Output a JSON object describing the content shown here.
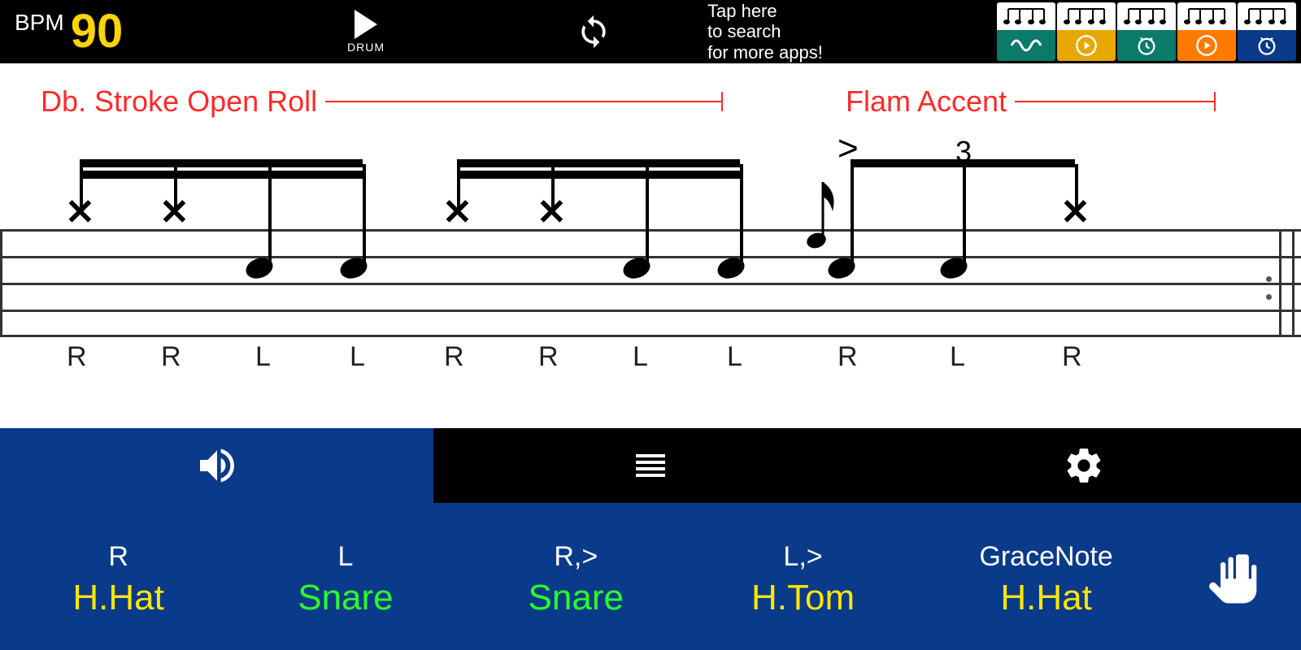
{
  "topbar": {
    "bpm_label": "BPM",
    "bpm_value": "90",
    "play_label": "DRUM",
    "ad_line1": "Tap here",
    "ad_line2": "to search",
    "ad_line3": "for more apps!",
    "thumbs": [
      {
        "bg": "#0a7a6a",
        "icon": "wave"
      },
      {
        "bg": "#e6a800",
        "icon": "play"
      },
      {
        "bg": "#0a7a6a",
        "icon": "clock"
      },
      {
        "bg": "#ff7b00",
        "icon": "play"
      },
      {
        "bg": "#0a3a8a",
        "icon": "clock"
      }
    ]
  },
  "score": {
    "rudiment_left": "Db. Stroke Open Roll",
    "rudiment_right": "Flam Accent",
    "triplet_label": "3",
    "accent_mark": ">",
    "notes": [
      {
        "head": "x",
        "stick": "R"
      },
      {
        "head": "x",
        "stick": "R"
      },
      {
        "head": "dot",
        "stick": "L"
      },
      {
        "head": "dot",
        "stick": "L"
      },
      {
        "head": "x",
        "stick": "R"
      },
      {
        "head": "x",
        "stick": "R"
      },
      {
        "head": "dot",
        "stick": "L"
      },
      {
        "head": "dot",
        "stick": "L"
      },
      {
        "head": "dot",
        "stick": "R",
        "grace": true,
        "accent": true
      },
      {
        "head": "dot",
        "stick": "L"
      },
      {
        "head": "x",
        "stick": "R"
      }
    ]
  },
  "bottom": {
    "controls": [
      {
        "top": "R",
        "bot": "H.Hat",
        "color": "yellow"
      },
      {
        "top": "L",
        "bot": "Snare",
        "color": "green"
      },
      {
        "top": "R,>",
        "bot": "Snare",
        "color": "green"
      },
      {
        "top": "L,>",
        "bot": "H.Tom",
        "color": "yellow"
      },
      {
        "top": "GraceNote",
        "bot": "H.Hat",
        "color": "yellow"
      }
    ]
  }
}
